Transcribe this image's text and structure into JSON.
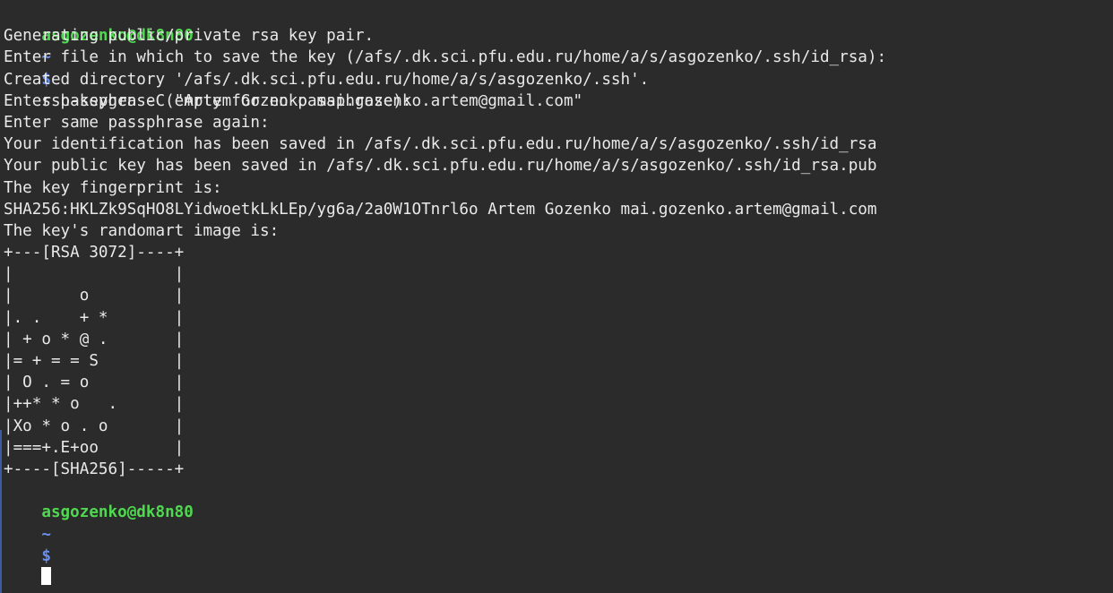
{
  "theme": {
    "background": "#2b2b2b",
    "foreground": "#e9e9e9",
    "prompt_user_color": "#50d850",
    "prompt_path_color": "#6a8ff0",
    "cursor_color": "#ffffff"
  },
  "prompt": {
    "user_host": "asgozenko@dk8n80",
    "path": "~",
    "symbol": "$"
  },
  "command": "ssh-keygen -C \"Artem Gozenko mai.gozenko.artem@gmail.com\"",
  "output_lines": [
    "Generating public/private rsa key pair.",
    "Enter file in which to save the key (/afs/.dk.sci.pfu.edu.ru/home/a/s/asgozenko/.ssh/id_rsa):",
    "Created directory '/afs/.dk.sci.pfu.edu.ru/home/a/s/asgozenko/.ssh'.",
    "Enter passphrase (empty for no passphrase):",
    "Enter same passphrase again:",
    "Your identification has been saved in /afs/.dk.sci.pfu.edu.ru/home/a/s/asgozenko/.ssh/id_rsa",
    "Your public key has been saved in /afs/.dk.sci.pfu.edu.ru/home/a/s/asgozenko/.ssh/id_rsa.pub",
    "The key fingerprint is:",
    "SHA256:HKLZk9SqHO8LYidwoetkLkLEp/yg6a/2a0W1OTnrl6o Artem Gozenko mai.gozenko.artem@gmail.com",
    "The key's randomart image is:",
    "+---[RSA 3072]----+",
    "|                 |",
    "|       o         |",
    "|. .    + *       |",
    "| + o * @ .       |",
    "|= + = = S        |",
    "| O . = o         |",
    "|++* * o   .      |",
    "|Xo * o . o       |",
    "|===+.E+oo        |",
    "+----[SHA256]-----+"
  ]
}
